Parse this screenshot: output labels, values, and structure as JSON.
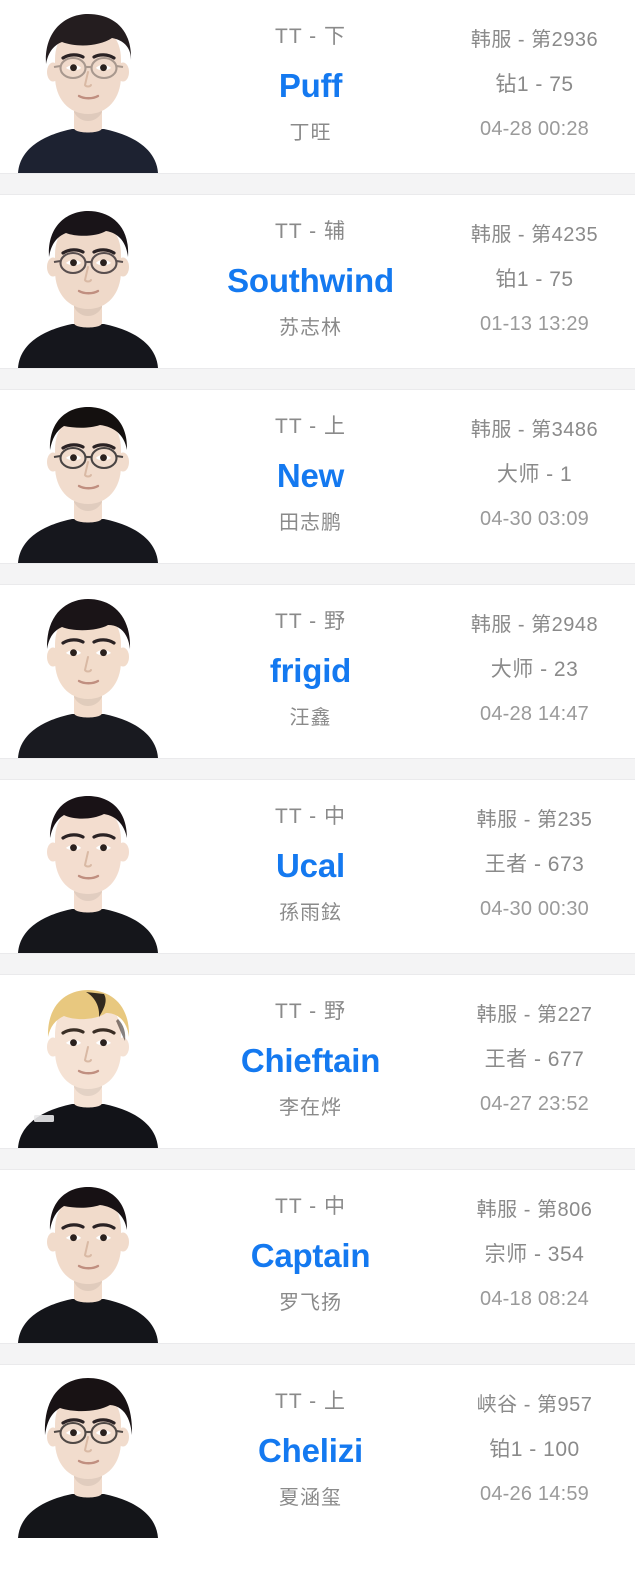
{
  "list": {
    "name": "pro-player-rank-list",
    "accent_color": "#1479f0",
    "muted_color": "#8a8a8a",
    "separator_color": "#f4f4f5",
    "background_color": "#ffffff",
    "rows": [
      {
        "role_line": "TT - 下",
        "ign": "Puff",
        "real_name": "丁旺",
        "server_rank": "韩服 - 第2936",
        "tier_points": "钻1 - 75",
        "updated": "04-28 00:28",
        "avatar": {
          "name": "player-avatar-puff",
          "hair": "#241d1f",
          "hair_style": "wavy-fringe",
          "skin": "#f0dacb",
          "shirt": "#1d2231",
          "glasses": true,
          "glasses_color": "#9c8d84"
        }
      },
      {
        "role_line": "TT - 辅",
        "ign": "Southwind",
        "real_name": "苏志林",
        "server_rank": "韩服 - 第4235",
        "tier_points": "铂1 - 75",
        "updated": "01-13 13:29",
        "avatar": {
          "name": "player-avatar-southwind",
          "hair": "#191418",
          "hair_style": "short-spiky",
          "skin": "#efd9c9",
          "shirt": "#15161c",
          "glasses": true,
          "glasses_color": "#40383a"
        }
      },
      {
        "role_line": "TT - 上",
        "ign": "New",
        "real_name": "田志鹏",
        "server_rank": "韩服 - 第3486",
        "tier_points": "大师 - 1",
        "updated": "04-30 03:09",
        "avatar": {
          "name": "player-avatar-new",
          "hair": "#14100f",
          "hair_style": "short-crop",
          "skin": "#f1dccd",
          "shirt": "#16171d",
          "glasses": true,
          "glasses_color": "#2c2a2c"
        }
      },
      {
        "role_line": "TT - 野",
        "ign": "frigid",
        "real_name": "汪鑫",
        "server_rank": "韩服 - 第2948",
        "tier_points": "大师 - 23",
        "updated": "04-28 14:47",
        "avatar": {
          "name": "player-avatar-frigid",
          "hair": "#1a1417",
          "hair_style": "bowl-fringe",
          "skin": "#f2dccb",
          "shirt": "#191a20",
          "glasses": false,
          "glasses_color": "#000000"
        }
      },
      {
        "role_line": "TT - 中",
        "ign": "Ucal",
        "real_name": "孫雨鉉",
        "server_rank": "韩服 - 第235",
        "tier_points": "王者 - 673",
        "updated": "04-30 00:30",
        "avatar": {
          "name": "player-avatar-ucal",
          "hair": "#191216",
          "hair_style": "straight-bangs",
          "skin": "#f3ddcf",
          "shirt": "#15161b",
          "glasses": false,
          "glasses_color": "#000000"
        }
      },
      {
        "role_line": "TT - 野",
        "ign": "Chieftain",
        "real_name": "李在烨",
        "server_rank": "韩服 - 第227",
        "tier_points": "王者 - 677",
        "updated": "04-27 23:52",
        "avatar": {
          "name": "player-avatar-chieftain",
          "hair": "#e8c87f",
          "hair_style": "blonde-fringe",
          "skin": "#f5e2d4",
          "shirt": "#121318",
          "glasses": false,
          "glasses_color": "#000000"
        }
      },
      {
        "role_line": "TT - 中",
        "ign": "Captain",
        "real_name": "罗飞扬",
        "server_rank": "韩服 - 第806",
        "tier_points": "宗师 - 354",
        "updated": "04-18 08:24",
        "avatar": {
          "name": "player-avatar-captain",
          "hair": "#171114",
          "hair_style": "short-crop",
          "skin": "#f1dbcb",
          "shirt": "#14151a",
          "glasses": false,
          "glasses_color": "#000000"
        }
      },
      {
        "role_line": "TT - 上",
        "ign": "Chelizi",
        "real_name": "夏涵玺",
        "server_rank": "峡谷 - 第957",
        "tier_points": "铂1 - 100",
        "updated": "04-26 14:59",
        "avatar": {
          "name": "player-avatar-chelizi",
          "hair": "#181214",
          "hair_style": "messy-long",
          "skin": "#f1dccd",
          "shirt": "#141519",
          "glasses": true,
          "glasses_color": "#35302f"
        }
      }
    ]
  }
}
